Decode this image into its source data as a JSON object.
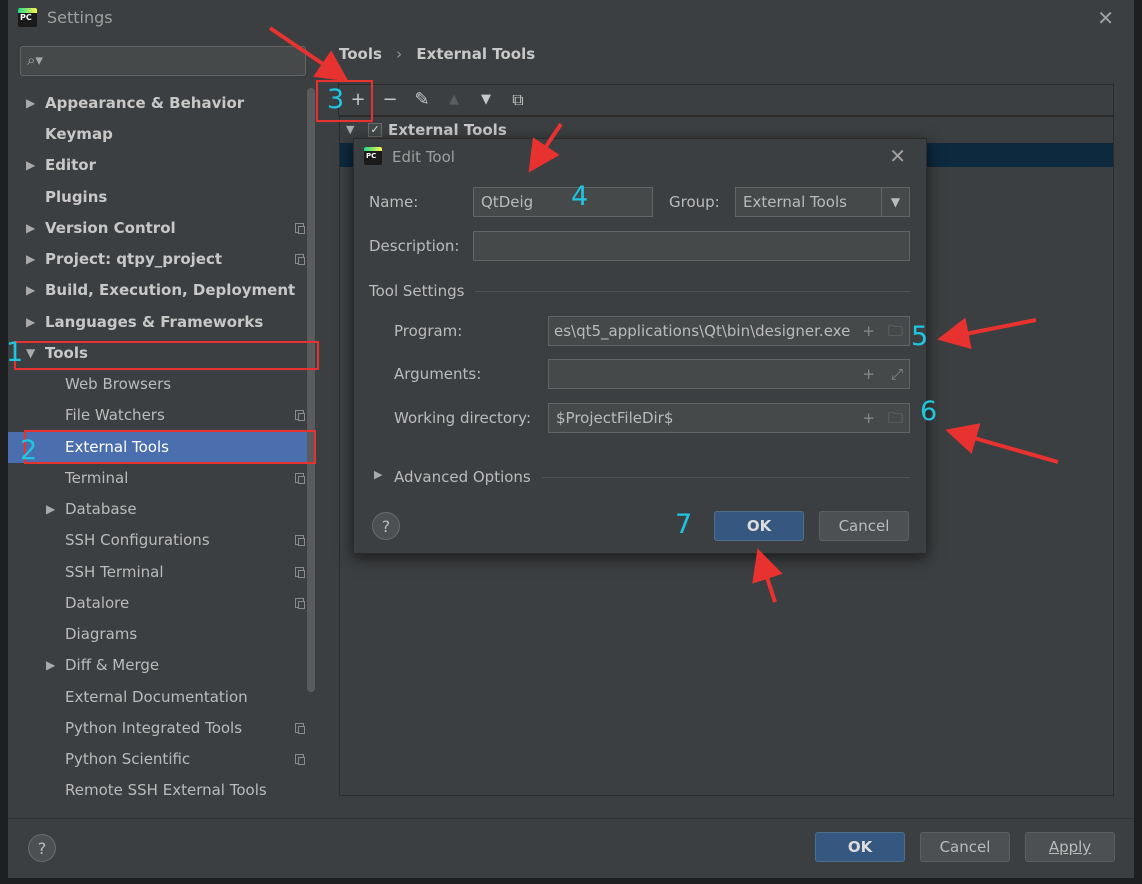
{
  "window": {
    "title": "Settings",
    "app_icon_text": "PC"
  },
  "search": {
    "placeholder": ""
  },
  "sidebar": {
    "items": [
      {
        "label": "Appearance & Behavior",
        "expandable": true,
        "bold": true
      },
      {
        "label": "Keymap",
        "bold": true
      },
      {
        "label": "Editor",
        "expandable": true,
        "bold": true
      },
      {
        "label": "Plugins",
        "bold": true
      },
      {
        "label": "Version Control",
        "expandable": true,
        "bold": true,
        "project_icon": true
      },
      {
        "label": "Project: qtpy_project",
        "expandable": true,
        "bold": true,
        "project_icon": true
      },
      {
        "label": "Build, Execution, Deployment",
        "expandable": true,
        "bold": true
      },
      {
        "label": "Languages & Frameworks",
        "expandable": true,
        "bold": true
      },
      {
        "label": "Tools",
        "expanded": true,
        "bold": true
      },
      {
        "label": "Web Browsers"
      },
      {
        "label": "File Watchers",
        "project_icon": true
      },
      {
        "label": "External Tools",
        "selected": true
      },
      {
        "label": "Terminal",
        "project_icon": true
      },
      {
        "label": "Database",
        "expandable": true
      },
      {
        "label": "SSH Configurations",
        "project_icon": true
      },
      {
        "label": "SSH Terminal",
        "project_icon": true
      },
      {
        "label": "Datalore",
        "project_icon": true
      },
      {
        "label": "Diagrams"
      },
      {
        "label": "Diff & Merge",
        "expandable": true
      },
      {
        "label": "External Documentation"
      },
      {
        "label": "Python Integrated Tools",
        "project_icon": true
      },
      {
        "label": "Python Scientific",
        "project_icon": true
      },
      {
        "label": "Remote SSH External Tools"
      }
    ]
  },
  "breadcrumb": {
    "parent": "Tools",
    "separator": "›",
    "current": "External Tools"
  },
  "toolbar": {
    "add": "+",
    "remove": "−",
    "edit": "✎",
    "up": "▲",
    "down": "▼",
    "copy": "⧉"
  },
  "tree": {
    "group_label": "External Tools",
    "group_checked": true
  },
  "dialog": {
    "title": "Edit Tool",
    "name_label": "Name:",
    "name_value": "QtDeig",
    "group_label": "Group:",
    "group_value": "External Tools",
    "description_label": "Description:",
    "description_value": "",
    "tool_settings_label": "Tool Settings",
    "program_label": "Program:",
    "program_value": "es\\qt5_applications\\Qt\\bin\\designer.exe",
    "arguments_label": "Arguments:",
    "arguments_value": "",
    "workdir_label": "Working directory:",
    "workdir_value": "$ProjectFileDir$",
    "advanced_label": "Advanced Options",
    "ok_label": "OK",
    "cancel_label": "Cancel",
    "help_label": "?"
  },
  "footer": {
    "help_label": "?",
    "ok_label": "OK",
    "cancel_label": "Cancel",
    "apply_label": "Apply"
  },
  "annotations": [
    "1",
    "2",
    "3",
    "4",
    "5",
    "6",
    "7"
  ],
  "colors": {
    "accent": "#4b6eaf",
    "annotation_number": "#1fc6e0",
    "annotation_red": "#e8322f",
    "primary_button": "#365880"
  }
}
